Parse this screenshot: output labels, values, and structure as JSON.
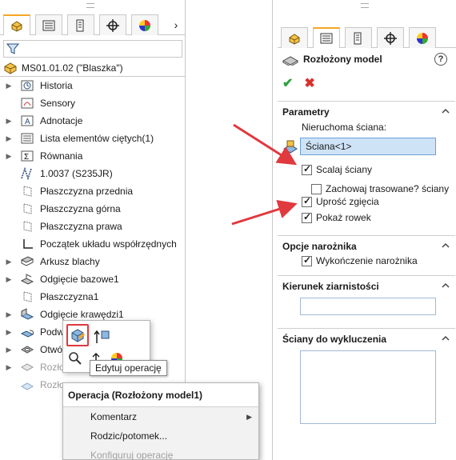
{
  "left_panel": {
    "root_label": "MS01.01.02 (\"Blaszka\")",
    "tree": [
      {
        "label": "Historia",
        "icon": "history-icon",
        "expandable": true
      },
      {
        "label": "Sensory",
        "icon": "sensors-icon",
        "expandable": false
      },
      {
        "label": "Adnotacje",
        "icon": "annotations-icon",
        "expandable": true
      },
      {
        "label": "Lista elementów ciętych(1)",
        "icon": "cut-list-icon",
        "expandable": true
      },
      {
        "label": "Równania",
        "icon": "equations-icon",
        "expandable": true
      },
      {
        "label": "1.0037 (S235JR)",
        "icon": "material-icon",
        "expandable": false
      },
      {
        "label": "Płaszczyzna przednia",
        "icon": "plane-icon",
        "expandable": false
      },
      {
        "label": "Płaszczyzna górna",
        "icon": "plane-icon",
        "expandable": false
      },
      {
        "label": "Płaszczyzna prawa",
        "icon": "plane-icon",
        "expandable": false
      },
      {
        "label": "Początek układu współrzędnych",
        "icon": "origin-icon",
        "expandable": false
      },
      {
        "label": "Arkusz blachy",
        "icon": "sheet-metal-icon",
        "expandable": true
      },
      {
        "label": "Odgięcie bazowe1",
        "icon": "base-flange-icon",
        "expandable": true
      },
      {
        "label": "Płaszczyzna1",
        "icon": "plane-icon",
        "expandable": false
      },
      {
        "label": "Odgięcie krawędzi1",
        "icon": "edge-flange-icon",
        "expandable": true
      },
      {
        "label": "Podw",
        "icon": "hem-icon",
        "expandable": true
      },
      {
        "label": "Otwó",
        "icon": "hole-icon",
        "expandable": true
      },
      {
        "label": "Rozło",
        "icon": "unfold-icon",
        "expandable": true,
        "dim": true
      },
      {
        "label": "Rozło",
        "icon": "flat-pattern-icon",
        "expandable": false,
        "dim": true
      }
    ],
    "tooltip": "Edytuj operację",
    "context_menu": {
      "header": "Operacja (Rozłożony model1)",
      "items": [
        {
          "label": "Komentarz",
          "submenu": true
        },
        {
          "label": "Rodzic/potomek...",
          "submenu": false
        },
        {
          "label": "Konfiguruj operację",
          "submenu": false,
          "disabled": true
        }
      ]
    }
  },
  "right_panel": {
    "title": "Rozłożony model",
    "help": "?",
    "ok": "✔",
    "cancel": "✖",
    "sections": {
      "parametry": {
        "title": "Parametry",
        "fixed_face_label": "Nieruchoma ściana:",
        "fixed_face_value": "Ściana<1>",
        "merge_faces": {
          "label": "Scalaj ściany",
          "checked": true
        },
        "keep_traced": {
          "label": "Zachowaj trasowane? ściany",
          "checked": false
        },
        "simplify_bends": {
          "label": "Uprość zgięcia",
          "checked": true
        },
        "show_slot": {
          "label": "Pokaż rowek",
          "checked": true
        }
      },
      "corner": {
        "title": "Opcje narożnika",
        "corner_treatment": {
          "label": "Wykończenie narożnika",
          "checked": true
        }
      },
      "grain": {
        "title": "Kierunek ziarnistości",
        "value": ""
      },
      "exclude": {
        "title": "Ściany do wykluczenia",
        "value": ""
      }
    }
  },
  "colors": {
    "accent_orange": "#f5a623",
    "arrow_red": "#e0393e",
    "ok_green": "#2ea043",
    "cancel_red": "#d9302c",
    "selection_blue": "#cfe3f7"
  }
}
